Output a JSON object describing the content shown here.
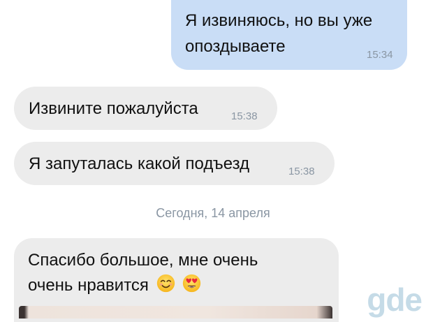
{
  "messages": [
    {
      "direction": "outgoing",
      "lines": [
        "Я извиняюсь, но вы уже",
        "опоздываете"
      ],
      "time": "15:34"
    },
    {
      "direction": "incoming",
      "lines": [
        "Извините пожалуйста"
      ],
      "time": "15:38"
    },
    {
      "direction": "incoming",
      "lines": [
        "Я запуталась какой подъезд"
      ],
      "time": "15:38"
    },
    {
      "direction": "incoming",
      "lines": [
        "Спасибо большое, мне очень",
        "очень нравится"
      ],
      "emojis": [
        "smiling-face-with-smiling-eyes",
        "smiling-face-with-heart-eyes"
      ]
    }
  ],
  "date_separator": "Сегодня, 14 апреля",
  "watermark": "gde",
  "colors": {
    "outgoing_bubble": "#c9ddf6",
    "incoming_bubble": "#ececec",
    "timestamp": "#8a96a3",
    "watermark": "#96bed4"
  }
}
